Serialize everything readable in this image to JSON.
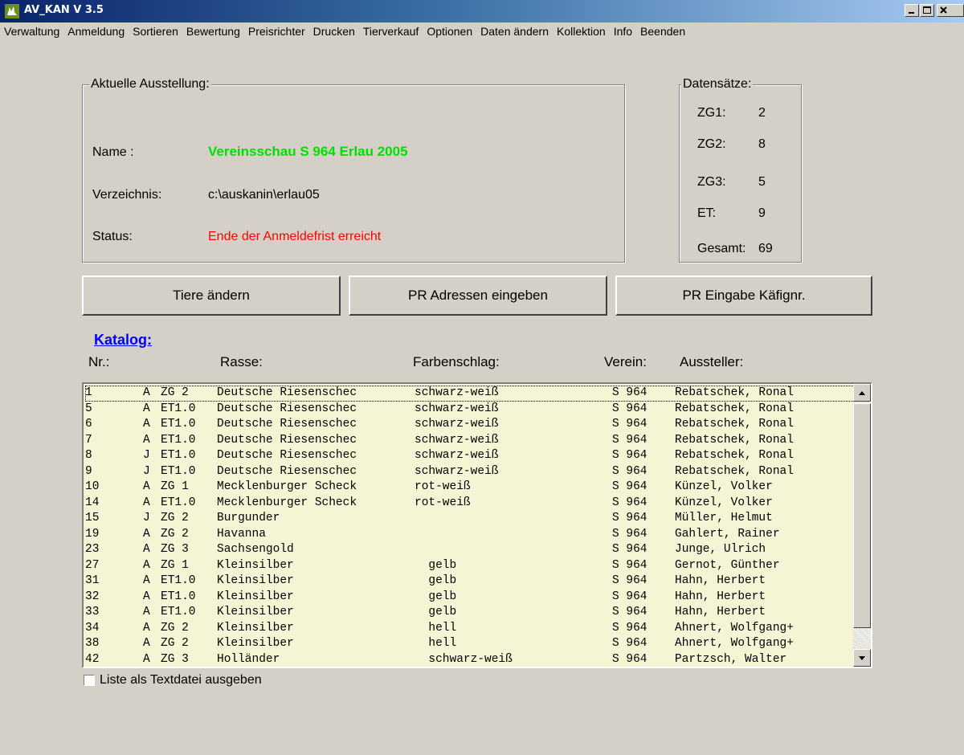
{
  "window": {
    "title": "AV_KAN V 3.5"
  },
  "menu": [
    "Verwaltung",
    "Anmeldung",
    "Sortieren",
    "Bewertung",
    "Preisrichter",
    "Drucken",
    "Tierverkauf",
    "Optionen",
    "Daten ändern",
    "Kollektion",
    "Info",
    "Beenden"
  ],
  "exhibition": {
    "group_title": "Aktuelle Ausstellung:",
    "name_label": "Name :",
    "name_value": "Vereinsschau S 964 Erlau 2005",
    "dir_label": "Verzeichnis:",
    "dir_value": "c:\\auskanin\\erlau05",
    "status_label": "Status:",
    "status_value": "Ende der Anmeldefrist erreicht",
    "name_color": "#00e000",
    "status_color": "#ff0000"
  },
  "records": {
    "group_title": "Datensätze:",
    "items": [
      {
        "label": "ZG1:",
        "value": "2"
      },
      {
        "label": "ZG2:",
        "value": "8"
      },
      {
        "label": "ZG3:",
        "value": "5"
      },
      {
        "label": "ET:",
        "value": "9"
      },
      {
        "label": "Gesamt:",
        "value": "69"
      }
    ]
  },
  "buttons": {
    "edit_animals": "Tiere ändern",
    "judge_addresses": "PR Adressen eingeben",
    "judge_cage": "PR Eingabe Käfignr."
  },
  "catalog": {
    "title": "Katalog:",
    "headers": {
      "nr": "Nr.:",
      "breed": "Rasse:",
      "color": "Farbenschlag:",
      "club": "Verein:",
      "exhibitor": "Aussteller:"
    },
    "rows": [
      [
        "1",
        "A",
        "ZG 2",
        "Deutsche Riesenschec",
        "schwarz-weiß",
        "S 964",
        "Rebatschek, Ronal"
      ],
      [
        "5",
        "A",
        "ET1.0",
        "Deutsche Riesenschec",
        "schwarz-weiß",
        "S 964",
        "Rebatschek, Ronal"
      ],
      [
        "6",
        "A",
        "ET1.0",
        "Deutsche Riesenschec",
        "schwarz-weiß",
        "S 964",
        "Rebatschek, Ronal"
      ],
      [
        "7",
        "A",
        "ET1.0",
        "Deutsche Riesenschec",
        "schwarz-weiß",
        "S 964",
        "Rebatschek, Ronal"
      ],
      [
        "8",
        "J",
        "ET1.0",
        "Deutsche Riesenschec",
        "schwarz-weiß",
        "S 964",
        "Rebatschek, Ronal"
      ],
      [
        "9",
        "J",
        "ET1.0",
        "Deutsche Riesenschec",
        "schwarz-weiß",
        "S 964",
        "Rebatschek, Ronal"
      ],
      [
        "10",
        "A",
        "ZG 1",
        "Mecklenburger Scheck",
        "rot-weiß",
        "S 964",
        "Künzel, Volker"
      ],
      [
        "14",
        "A",
        "ET1.0",
        "Mecklenburger Scheck",
        "rot-weiß",
        "S 964",
        "Künzel, Volker"
      ],
      [
        "15",
        "J",
        "ZG 2",
        "Burgunder",
        "",
        "S 964",
        "Müller, Helmut"
      ],
      [
        "19",
        "A",
        "ZG 2",
        "Havanna",
        "",
        "S 964",
        "Gahlert, Rainer"
      ],
      [
        "23",
        "A",
        "ZG 3",
        "Sachsengold",
        "",
        "S 964",
        "Junge, Ulrich"
      ],
      [
        "27",
        "A",
        "ZG 1",
        "Kleinsilber",
        "  gelb",
        "S 964",
        "Gernot, Günther"
      ],
      [
        "31",
        "A",
        "ET1.0",
        "Kleinsilber",
        "  gelb",
        "S 964",
        "Hahn, Herbert"
      ],
      [
        "32",
        "A",
        "ET1.0",
        "Kleinsilber",
        "  gelb",
        "S 964",
        "Hahn, Herbert"
      ],
      [
        "33",
        "A",
        "ET1.0",
        "Kleinsilber",
        "  gelb",
        "S 964",
        "Hahn, Herbert"
      ],
      [
        "34",
        "A",
        "ZG 2",
        "Kleinsilber",
        "  hell",
        "S 964",
        "Ahnert, Wolfgang+"
      ],
      [
        "38",
        "A",
        "ZG 2",
        "Kleinsilber",
        "  hell",
        "S 964",
        "Ahnert, Wolfgang+"
      ],
      [
        "42",
        "A",
        "ZG 3",
        "Holländer",
        "  schwarz-weiß",
        "S 964",
        "Partzsch, Walter"
      ]
    ]
  },
  "export_checkbox": {
    "label": "Liste als Textdatei ausgeben",
    "checked": false
  }
}
